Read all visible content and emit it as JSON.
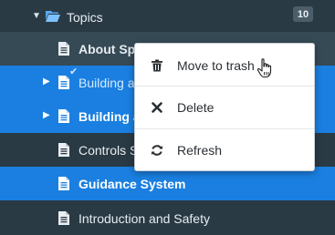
{
  "tree": {
    "root": {
      "label": "Topics",
      "count": "10"
    },
    "items": [
      {
        "label": "About Spa"
      },
      {
        "label": "Building a"
      },
      {
        "label": "Building a"
      },
      {
        "label": "Controls S"
      },
      {
        "label": "Guidance System"
      },
      {
        "label": "Introduction and Safety"
      }
    ]
  },
  "context_menu": {
    "items": [
      {
        "label": "Move to trash",
        "icon": "trash-icon"
      },
      {
        "label": "Delete",
        "icon": "close-icon"
      },
      {
        "label": "Refresh",
        "icon": "refresh-icon"
      }
    ]
  },
  "colors": {
    "background": "#2a3a44",
    "selected": "#1a7fe0",
    "hover": "#364a55",
    "menu": "#ffffff"
  }
}
